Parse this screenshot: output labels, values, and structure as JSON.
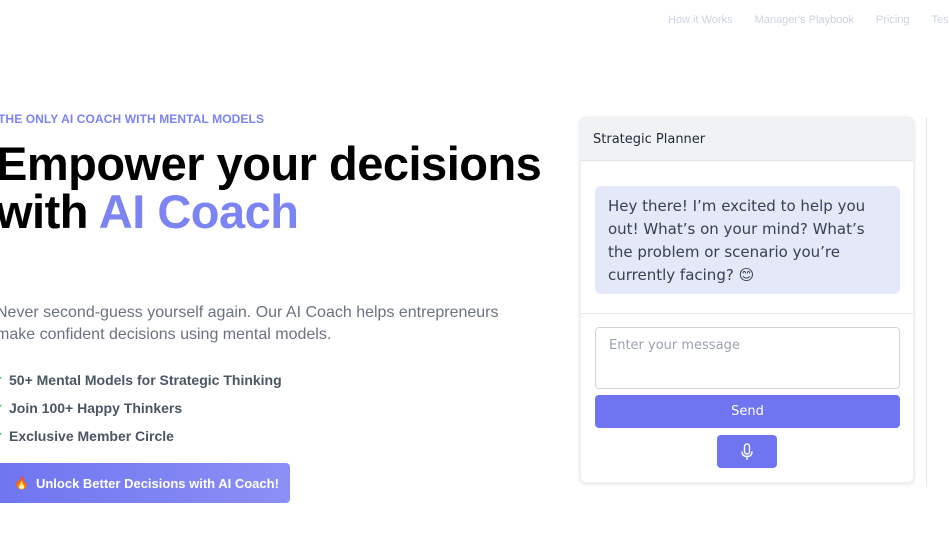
{
  "nav": {
    "items": [
      "How it Works",
      "Manager's Playbook",
      "Pricing",
      "Tes"
    ]
  },
  "hero": {
    "eyebrow": "THE ONLY AI COACH WITH MENTAL MODELS",
    "headline_main": "Empower your decisions with ",
    "headline_accent": "AI Coach",
    "subheadline": "Never second-guess yourself again. Our AI Coach helps entrepreneurs make confident decisions using mental models.",
    "features": [
      "50+ Mental Models for Strategic Thinking",
      "Join 100+ Happy Thinkers",
      "Exclusive Member Circle"
    ],
    "check_icon": "✓",
    "cta_icon": "🔥",
    "cta_label": "Unlock Better Decisions with AI Coach!"
  },
  "chat": {
    "title": "Strategic Planner",
    "assistant_message": "Hey there! I’m excited to help you out! What’s on your mind? What’s the problem or scenario you’re currently facing? 😊",
    "input_placeholder": "Enter your message",
    "input_value": "",
    "send_label": "Send",
    "mic_icon": "microphone-icon"
  },
  "colors": {
    "accent": "#7c83f2",
    "button": "#6f75f0",
    "bubble": "#e4e8f9",
    "check": "#22c55e"
  }
}
